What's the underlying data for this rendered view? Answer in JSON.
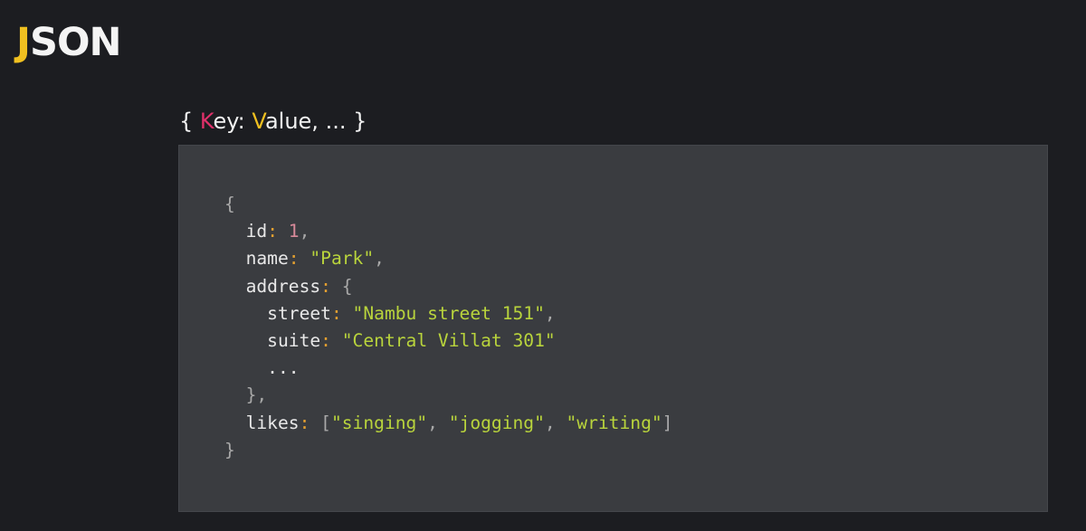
{
  "slide": {
    "title_first_letter": "J",
    "title_rest": "SON",
    "subtitle": {
      "open": "{ ",
      "key_first": "K",
      "key_rest": "ey: ",
      "value_first": "V",
      "value_rest": "alue, ... }"
    }
  },
  "colors": {
    "background": "#1c1d21",
    "code_background": "#3a3c40",
    "accent_yellow": "#f0c020",
    "accent_pink": "#e0306a",
    "string": "#b9d43c",
    "colon": "#e4a030",
    "number": "#d88a9a"
  },
  "code_lines": [
    [
      {
        "t": "{",
        "c": "punc"
      }
    ],
    [
      {
        "t": "  id",
        "c": "key"
      },
      {
        "t": ":",
        "c": "colon"
      },
      {
        "t": " 1",
        "c": "num"
      },
      {
        "t": ",",
        "c": "punc"
      }
    ],
    [
      {
        "t": "  name",
        "c": "key"
      },
      {
        "t": ":",
        "c": "colon"
      },
      {
        "t": " \"Park\"",
        "c": "str"
      },
      {
        "t": ",",
        "c": "punc"
      }
    ],
    [
      {
        "t": "  address",
        "c": "key"
      },
      {
        "t": ":",
        "c": "colon"
      },
      {
        "t": " {",
        "c": "punc"
      }
    ],
    [
      {
        "t": "    street",
        "c": "key"
      },
      {
        "t": ":",
        "c": "colon"
      },
      {
        "t": " \"Nambu street 151\"",
        "c": "str"
      },
      {
        "t": ",",
        "c": "punc"
      }
    ],
    [
      {
        "t": "    suite",
        "c": "key"
      },
      {
        "t": ":",
        "c": "colon"
      },
      {
        "t": " \"Central Villat 301\"",
        "c": "str"
      }
    ],
    [
      {
        "t": "    ...",
        "c": "key"
      }
    ],
    [
      {
        "t": "  },",
        "c": "punc"
      }
    ],
    [
      {
        "t": "  likes",
        "c": "key"
      },
      {
        "t": ":",
        "c": "colon"
      },
      {
        "t": " [",
        "c": "punc"
      },
      {
        "t": "\"singing\"",
        "c": "str"
      },
      {
        "t": ", ",
        "c": "punc"
      },
      {
        "t": "\"jogging\"",
        "c": "str"
      },
      {
        "t": ", ",
        "c": "punc"
      },
      {
        "t": "\"writing\"",
        "c": "str"
      },
      {
        "t": "]",
        "c": "punc"
      }
    ],
    [
      {
        "t": "}",
        "c": "punc"
      }
    ]
  ]
}
